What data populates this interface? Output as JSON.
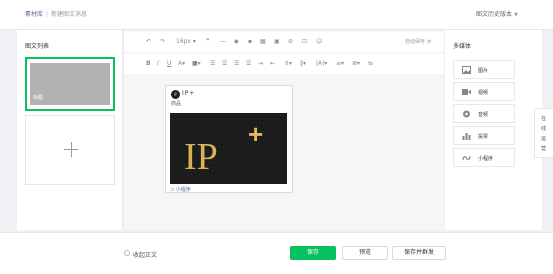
{
  "breadcrumb": {
    "root": "素材库",
    "current": "新建图文消息"
  },
  "history_label": "图文历史版本",
  "left_panel": {
    "title": "图文列表",
    "thumbnail_caption": "标题"
  },
  "toolbar": {
    "font_size": "16px",
    "autosave": "自动保存",
    "icons": [
      "undo-icon",
      "redo-icon",
      "font-size-select",
      "quote-icon",
      "divider-icon",
      "eraser-icon",
      "format-painter-icon",
      "table-icon",
      "image-icon",
      "link-icon",
      "code-icon",
      "emoji-icon",
      "bold-icon",
      "italic-icon",
      "underline-icon",
      "font-color-icon",
      "background-color-icon",
      "align-left-icon",
      "align-center-icon",
      "align-right-icon",
      "align-justify-icon",
      "indent-icon",
      "outdent-icon",
      "line-height-icon",
      "letter-spacing-icon",
      "list-icon",
      "ordered-list-icon",
      "superscript-icon",
      "text-direction-icon"
    ]
  },
  "card": {
    "logo": "IP",
    "name": "IP+",
    "subtitle": "商品",
    "image_text": "IP",
    "image_plus": "+",
    "footer": "小程序",
    "image_bg": "#1b1b1b",
    "gold": "#d8b25a"
  },
  "right_panel": {
    "title": "多媒体",
    "items": [
      {
        "label": "图片",
        "icon": "image-icon"
      },
      {
        "label": "视频",
        "icon": "video-icon"
      },
      {
        "label": "音频",
        "icon": "audio-icon"
      },
      {
        "label": "投票",
        "icon": "vote-icon"
      },
      {
        "label": "小程序",
        "icon": "mini-program-icon"
      }
    ]
  },
  "side_button": {
    "chars": [
      "在",
      "线",
      "运",
      "营"
    ]
  },
  "footer": {
    "radio_label": "收起正文",
    "save": "保存",
    "preview": "预览",
    "save_mass": "保存并群发"
  },
  "colors": {
    "accent": "#07c160",
    "link": "#576b95"
  }
}
